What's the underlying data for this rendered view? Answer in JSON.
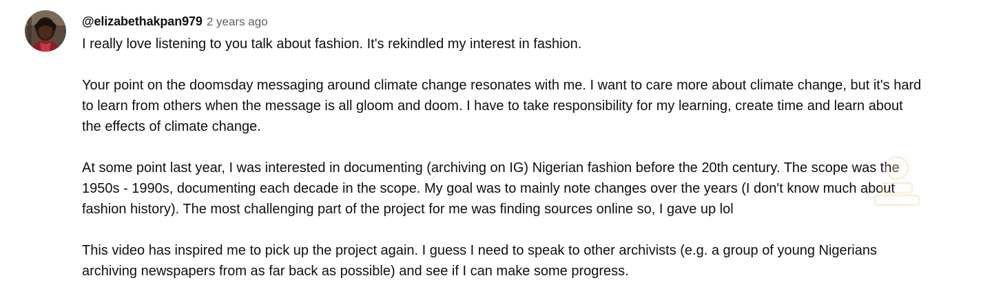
{
  "comment": {
    "author": "@elizabethakpan979",
    "timestamp": "2 years ago",
    "avatar_icon": "user-avatar-photo",
    "paragraphs": [
      "I really love listening to you talk about fashion. It's rekindled my interest in fashion.",
      "Your point on the doomsday messaging around climate change resonates with me. I want to care more about climate change, but it's hard\nto learn from others when the message is all gloom and doom. I have to take responsibility for my learning, create time and learn about\nthe effects of climate change.",
      "At some point last year, I was interested in documenting (archiving on IG) Nigerian fashion before the 20th century. The scope was the\n1950s - 1990s, documenting each decade in the scope. My goal was to mainly note changes over the years (I don't know much about\nfashion history). The most challenging part of the project for me was finding sources online so, I gave up lol",
      "This video has inspired me to pick up the project again. I guess I need to speak to other archivists (e.g. a group of young Nigerians\narchiving newspapers from as far back as possible) and see if I can make some progress."
    ]
  },
  "colors": {
    "author": "#0f0f0f",
    "timestamp": "#606060",
    "text": "#0f0f0f",
    "watermark": "#f2e6b8"
  },
  "watermark_icon": "faint-watermark-logo"
}
